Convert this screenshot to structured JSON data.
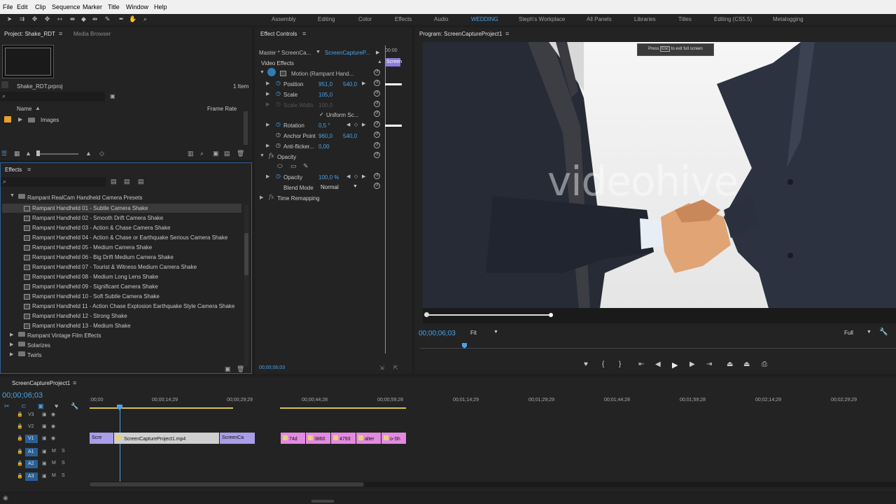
{
  "menu": [
    "File",
    "Edit",
    "Clip",
    "Sequence",
    "Marker",
    "Title",
    "Window",
    "Help"
  ],
  "workspaces": [
    "Assembly",
    "Editing",
    "Color",
    "Effects",
    "Audio",
    "WEDDING",
    "Steph's Workplace",
    "All Panels",
    "Libraries",
    "Titles",
    "Editing (CS5.5)",
    "Metalogging"
  ],
  "project": {
    "tab": "Project: Shake_RDT",
    "tab2": "Media Browser",
    "file": "Shake_RDT.prproj",
    "count": "1 Item",
    "col_name": "Name",
    "col_fr": "Frame Rate",
    "item": "Images"
  },
  "effects": {
    "tab": "Effects",
    "group": "Rampant RealCam Handheld Camera Presets",
    "items": [
      "Rampant Handheld 01 - Subtle Camera Shake",
      "Rampant Handheld 02 - Smooth Drift Camera Shake",
      "Rampant Handheld 03 - Action & Chase Camera Shake",
      "Rampant Handheld 04 - Action & Chase or Earthquake Serious Camera Shake",
      "Rampant Handheld 05 - Medium Camera Shake",
      "Rampant Handheld 06 - Big Drift Medium Camera Shake",
      "Rampant Handheld 07 - Tourist & Witness Medium Camera Shake",
      "Rampant Handheld 08 - Medium Long Lens Shake",
      "Rampant Handheld 09 - Significant Camera Shake",
      "Rampant Handheld 10 - Soft Subtle Camera Shake",
      "Rampant Handheld 11 - Action Chase Explosion Earthquake Style Camera Shake",
      "Rampant Handheld 12 - Strong Shake",
      "Rampant Handheld 13 - Medium Shake"
    ],
    "folders": [
      "Rampant Vintage Film Effects",
      "Solarizes",
      "Twirls"
    ]
  },
  "ec": {
    "tab": "Effect Controls",
    "master": "Master * ScreenCa...",
    "clip": "ScreenCaptureP...",
    "timecode_ruler": "00:00",
    "clip_bar": "Screen",
    "section": "Video Effects",
    "motion": "Motion (Rampant Hand...",
    "position_label": "Position",
    "position_x": "951,0",
    "position_y": "540,0",
    "scale_label": "Scale",
    "scale_val": "105,0",
    "scalew_label": "Scale Width",
    "scalew_val": "100,0",
    "uniform": "Uniform Sc...",
    "rotation_label": "Rotation",
    "rotation_val": "0,5 °",
    "anchor_label": "Anchor Point",
    "anchor_x": "960,0",
    "anchor_y": "540,0",
    "flicker_label": "Anti-flicker...",
    "flicker_val": "0,00",
    "opacity_section": "Opacity",
    "opacity_label": "Opacity",
    "opacity_val": "100,0 %",
    "blend_label": "Blend Mode",
    "blend_val": "Normal",
    "remap": "Time Remapping",
    "footer_tc": "00;00;06;03"
  },
  "program": {
    "tab": "Program: ScreenCaptureProject1",
    "esc_pre": "Press",
    "esc_key": "Esc",
    "esc_post": "to exit full screen",
    "watermark": "videohive",
    "timecode": "00;00;06;03",
    "fit": "Fit",
    "quality": "Full"
  },
  "timeline": {
    "tab": "ScreenCaptureProject1",
    "timecode": "00;00;06;03",
    "ruler": [
      ":00;00",
      "00;00;14;29",
      "00;00;29;29",
      "00;00;44;28",
      "00;00;59;28",
      "00;01;14;29",
      "00;01;29;29",
      "00;01;44;28",
      "00;01;59;28",
      "00;02;14;29",
      "00;02;29;29"
    ],
    "tracks": [
      "V3",
      "V2",
      "V1",
      "A1",
      "A2",
      "A3"
    ],
    "clips_v1": [
      "Scre",
      "ScreenCaptureProject1.mp4",
      "ScreenCa"
    ],
    "clips_pink": [
      "74d",
      "3860",
      "4793",
      "alter",
      "o-Sh"
    ]
  }
}
